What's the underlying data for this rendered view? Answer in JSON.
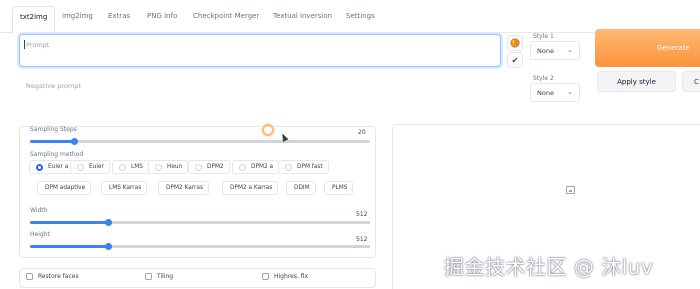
{
  "tabs": [
    {
      "label": "txt2img",
      "active": true
    },
    {
      "label": "img2img"
    },
    {
      "label": "Extras"
    },
    {
      "label": "PNG Info"
    },
    {
      "label": "Checkpoint Merger"
    },
    {
      "label": "Textual inversion"
    },
    {
      "label": "Settings"
    }
  ],
  "prompt": {
    "placeholder": "Prompt",
    "value": ""
  },
  "negative_prompt": {
    "placeholder": "Negative prompt",
    "value": ""
  },
  "styles": {
    "style1": {
      "label": "Style 1",
      "value": "None"
    },
    "style2": {
      "label": "Style 2",
      "value": "None"
    }
  },
  "buttons": {
    "generate": "Generate",
    "apply_style": "Apply style",
    "apply_style_2": "C"
  },
  "icons": {
    "paint_palette": "palette-icon",
    "check": "✔",
    "chevron": "⌄",
    "image_placeholder": "image-icon"
  },
  "colors": {
    "accent": "#3b82f6",
    "generate": "#fb923c"
  },
  "sampling_steps": {
    "label": "Sampling Steps",
    "value": "20",
    "fraction": 0.13
  },
  "sampling_method": {
    "label": "Sampling method",
    "options": [
      "Euler a",
      "Euler",
      "LMS",
      "Heun",
      "DPM2",
      "DPM2 a",
      "DPM fast",
      "DPM adaptive",
      "LMS Karras",
      "DPM2 Karras",
      "DPM2 a Karras",
      "DDIM",
      "PLMS"
    ],
    "selected": "Euler a"
  },
  "width": {
    "label": "Width",
    "value": "512",
    "fraction": 0.23
  },
  "height": {
    "label": "Height",
    "value": "512",
    "fraction": 0.23
  },
  "checkboxes": {
    "restore_faces": "Restore faces",
    "tiling": "Tiling",
    "highres": "Highres. fix"
  },
  "watermark": "掘金技术社区 @ 沐luv"
}
